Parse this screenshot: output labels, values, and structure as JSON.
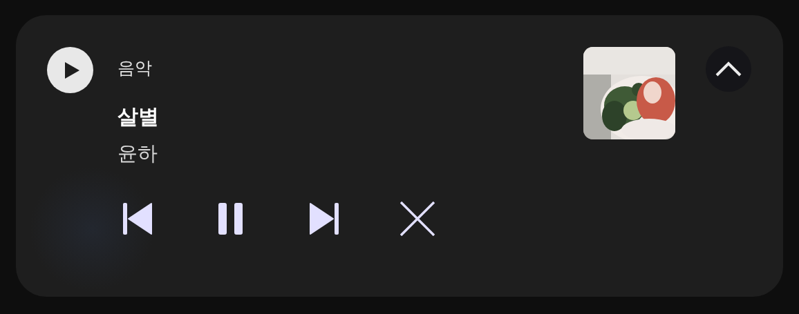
{
  "notification": {
    "app_button": {
      "kind": "play"
    },
    "app_name": "음악",
    "title": "살별",
    "artist": "윤하",
    "expanded": true,
    "controls": [
      {
        "kind": "previous"
      },
      {
        "kind": "pause"
      },
      {
        "kind": "next"
      },
      {
        "kind": "close"
      }
    ]
  }
}
